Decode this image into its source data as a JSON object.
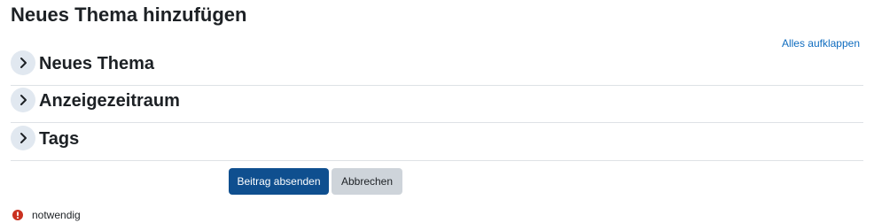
{
  "page": {
    "title": "Neues Thema hinzufügen",
    "expand_all_label": "Alles aufklappen"
  },
  "sections": [
    {
      "label": "Neues Thema",
      "icon": "chevron-right-icon"
    },
    {
      "label": "Anzeigezeitraum",
      "icon": "chevron-right-icon"
    },
    {
      "label": "Tags",
      "icon": "chevron-right-icon"
    }
  ],
  "actions": {
    "submit_label": "Beitrag absenden",
    "cancel_label": "Abbrechen"
  },
  "legend": {
    "required_icon": "exclamation-circle-icon",
    "required_label": "notwendig"
  },
  "colors": {
    "primary": "#0f4f8f",
    "link": "#0f6cbf",
    "required": "#ca3120",
    "toggle_bg": "#e1e8f0",
    "secondary_button": "#ced4da"
  }
}
